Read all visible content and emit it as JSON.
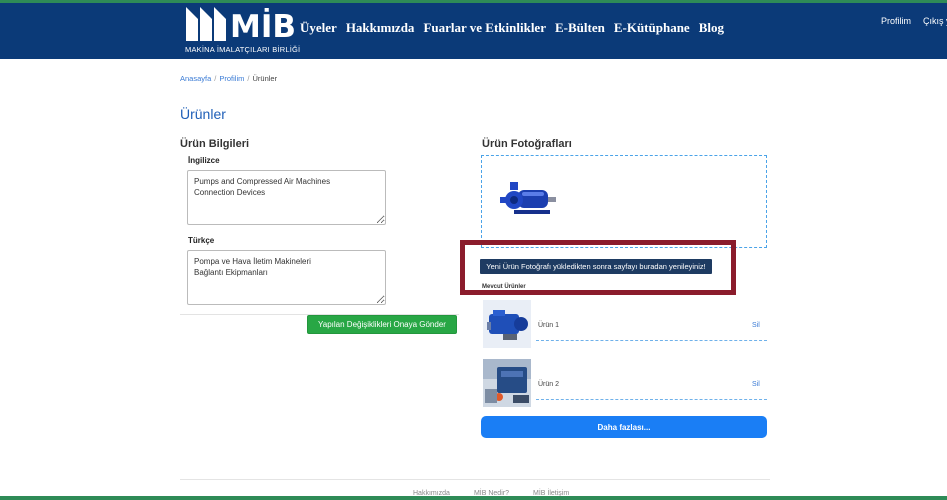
{
  "brand": {
    "logo_text": "MİB",
    "logo_subtitle": "MAKİNA İMALATÇILARI BİRLİĞİ"
  },
  "nav": {
    "items": [
      {
        "label": "Üyeler"
      },
      {
        "label": "Hakkımızda"
      },
      {
        "label": "Fuarlar ve Etkinlikler"
      },
      {
        "label": "E-Bülten"
      },
      {
        "label": "E-Kütüphane"
      },
      {
        "label": "Blog"
      }
    ],
    "profile": "Profilim",
    "logout": "Çıkış yap"
  },
  "breadcrumb": {
    "home": "Anasayfa",
    "profile": "Profilim",
    "current": "Ürünler",
    "separator": "/"
  },
  "page_title": "Ürünler",
  "product_info": {
    "title": "Ürün Bilgileri",
    "english_label": "İngilizce",
    "english_value": "Pumps and Compressed Air Machines\nConnection Devices",
    "turkish_label": "Türkçe",
    "turkish_value": "Pompa ve Hava İletim Makineleri\nBağlantı Ekipmanları",
    "submit_label": "Yapılan Değişiklikleri Onaya Gönder"
  },
  "photos": {
    "title": "Ürün Fotoğrafları",
    "refresh_label": "Yeni Ürün Fotoğrafı yükledikten sonra sayfayı buradan yenileyiniz!",
    "existing_label": "Mevcut Ürünler",
    "products": [
      {
        "name": "Ürün 1",
        "delete": "Sil"
      },
      {
        "name": "Ürün 2",
        "delete": "Sil"
      }
    ],
    "more_label": "Daha fazlası..."
  },
  "footer": {
    "links": [
      {
        "label": "Hakkımızda"
      },
      {
        "label": "MİB Nedir?"
      },
      {
        "label": "MİB İletişim"
      }
    ]
  },
  "colors": {
    "navbar": "#0b3a78",
    "accent_green": "#28a745",
    "highlight": "#8b1c2c",
    "primary_blue": "#1a7ef5"
  }
}
